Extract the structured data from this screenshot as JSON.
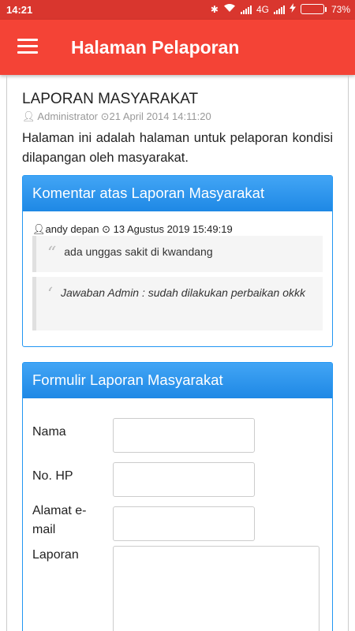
{
  "status_bar": {
    "time": "14:21",
    "network": "4G",
    "battery": "73%",
    "battery_level": 0.73,
    "icons": [
      "bluetooth-icon",
      "wifi-icon",
      "signal-icon",
      "charging-icon",
      "battery-icon"
    ]
  },
  "app_bar": {
    "title": "Halaman Pelaporan",
    "menu_icon": "hamburger-menu-icon",
    "color": "#f44336"
  },
  "article": {
    "title": "LAPORAN MASYARAKAT",
    "author": "Administrator",
    "date": "21 April 2014 14:11:20",
    "intro": "Halaman ini adalah halaman untuk pelaporan kondisi dilapangan oleh masyarakat."
  },
  "comments_panel": {
    "heading": "Komentar atas Laporan Masyarakat",
    "comment": {
      "user": "andy depan",
      "datetime": "13 Agustus 2019 15:49:19",
      "text": "ada unggas sakit di kwandang",
      "reply": "Jawaban Admin : sudah dilakukan perbaikan okkk"
    }
  },
  "form_panel": {
    "heading": "Formulir Laporan Masyarakat",
    "fields": {
      "name_label": "Nama",
      "phone_label": "No. HP",
      "email_label": "Alamat e-mail",
      "report_label": "Laporan"
    }
  },
  "colors": {
    "status_bar": "#d9362e",
    "app_bar": "#f44336",
    "panel_border": "#2196f3",
    "panel_header": "#1e88e5"
  }
}
